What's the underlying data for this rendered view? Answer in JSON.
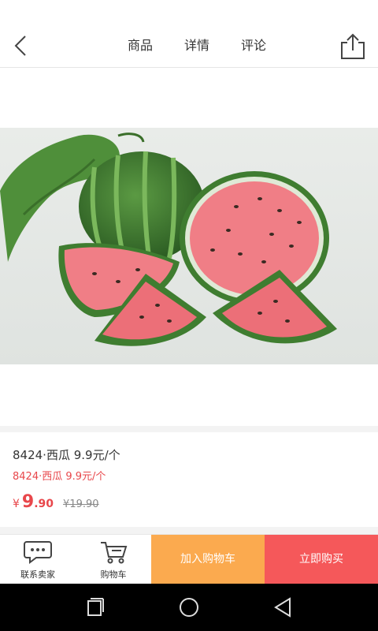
{
  "header": {
    "back_icon": "chevron-left-icon",
    "tabs": [
      {
        "label": "商品",
        "active": true
      },
      {
        "label": "详情",
        "active": false
      },
      {
        "label": "评论",
        "active": false
      }
    ],
    "share_icon": "share-icon"
  },
  "product": {
    "title": "8424·西瓜  9.9元/个",
    "subtitle": "8424·西瓜  9.9元/个",
    "price_symbol": "¥",
    "price_int": "9",
    "price_dec": ".90",
    "old_price": "¥19.90"
  },
  "bottom_bar": {
    "contact_label": "联系卖家",
    "cart_label": "购物车",
    "add_cart_label": "加入购物车",
    "buy_now_label": "立即购买"
  },
  "colors": {
    "price_red": "#e8474b",
    "add_cart_bg": "#fbaa4f",
    "buy_now_bg": "#f5585a"
  }
}
